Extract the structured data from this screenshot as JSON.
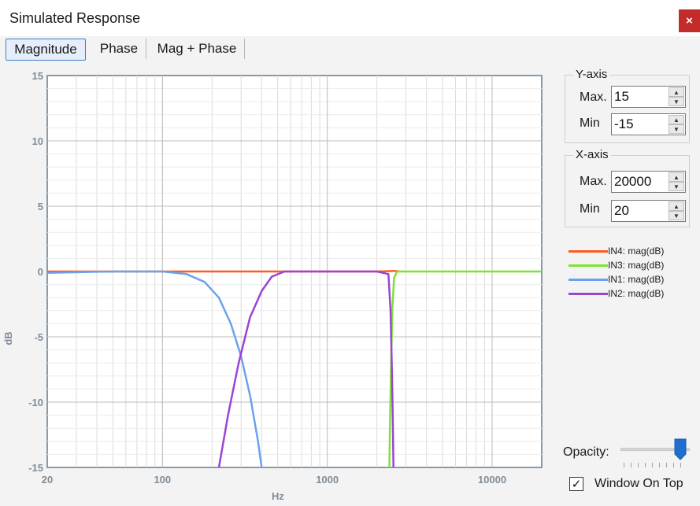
{
  "window": {
    "title": "Simulated Response",
    "close_label": "×"
  },
  "tabs": [
    {
      "label": "Magnitude",
      "active": true
    },
    {
      "label": "Phase",
      "active": false
    },
    {
      "label": "Mag + Phase",
      "active": false
    }
  ],
  "y_axis_group": {
    "title": "Y-axis",
    "max_label": "Max.",
    "max_value": "15",
    "min_label": "Min",
    "min_value": "-15"
  },
  "x_axis_group": {
    "title": "X-axis",
    "max_label": "Max.",
    "max_value": "20000",
    "min_label": "Min",
    "min_value": "20"
  },
  "controls": {
    "opacity_label": "Opacity:",
    "opacity_value": 0.95,
    "window_on_top_label": "Window On Top",
    "window_on_top_checked": true,
    "check_glyph": "✓"
  },
  "colors": {
    "accent": "#1e6fd0",
    "close": "#c42b2b"
  },
  "chart_data": {
    "type": "line",
    "xlabel": "Hz",
    "ylabel": "dB",
    "xscale": "log",
    "xlim": [
      20,
      20000
    ],
    "ylim": [
      -15,
      15
    ],
    "grid": true,
    "legend_position": "right",
    "x_ticks": [
      {
        "value": 20,
        "label": "20"
      },
      {
        "value": 100,
        "label": "100"
      },
      {
        "value": 1000,
        "label": "1000"
      },
      {
        "value": 10000,
        "label": "10000"
      }
    ],
    "y_ticks": [
      {
        "value": 15,
        "label": "15"
      },
      {
        "value": 10,
        "label": "10"
      },
      {
        "value": 5,
        "label": "5"
      },
      {
        "value": 0,
        "label": "0"
      },
      {
        "value": -5,
        "label": "-5"
      },
      {
        "value": -10,
        "label": "-10"
      },
      {
        "value": -15,
        "label": "-15"
      }
    ],
    "series": [
      {
        "name": "IN4: mag(dB)",
        "color": "#ff5a1f",
        "points": [
          [
            20,
            0
          ],
          [
            100,
            0
          ],
          [
            500,
            0
          ],
          [
            1000,
            0
          ],
          [
            2000,
            0
          ],
          [
            2600,
            0.05
          ],
          [
            2750,
            0
          ]
        ]
      },
      {
        "name": "IN3: mag(dB)",
        "color": "#7ee331",
        "points": [
          [
            2380,
            -15
          ],
          [
            2400,
            -12
          ],
          [
            2430,
            -8
          ],
          [
            2480,
            -3
          ],
          [
            2540,
            -0.5
          ],
          [
            2650,
            0
          ],
          [
            5000,
            0
          ],
          [
            20000,
            0
          ]
        ]
      },
      {
        "name": "IN1: mag(dB)",
        "color": "#6aa2ec",
        "points": [
          [
            20,
            -0.1
          ],
          [
            50,
            0
          ],
          [
            100,
            0
          ],
          [
            140,
            -0.2
          ],
          [
            180,
            -0.8
          ],
          [
            220,
            -2
          ],
          [
            260,
            -4
          ],
          [
            300,
            -6.5
          ],
          [
            340,
            -9.5
          ],
          [
            380,
            -13
          ],
          [
            400,
            -15
          ]
        ]
      },
      {
        "name": "IN2: mag(dB)",
        "color": "#9a45d4",
        "points": [
          [
            220,
            -15
          ],
          [
            250,
            -11
          ],
          [
            290,
            -7
          ],
          [
            340,
            -3.5
          ],
          [
            400,
            -1.5
          ],
          [
            460,
            -0.4
          ],
          [
            550,
            0
          ],
          [
            1000,
            0
          ],
          [
            2000,
            0
          ],
          [
            2350,
            -0.2
          ],
          [
            2420,
            -3
          ],
          [
            2470,
            -8
          ],
          [
            2500,
            -12
          ],
          [
            2520,
            -15
          ]
        ]
      }
    ]
  }
}
